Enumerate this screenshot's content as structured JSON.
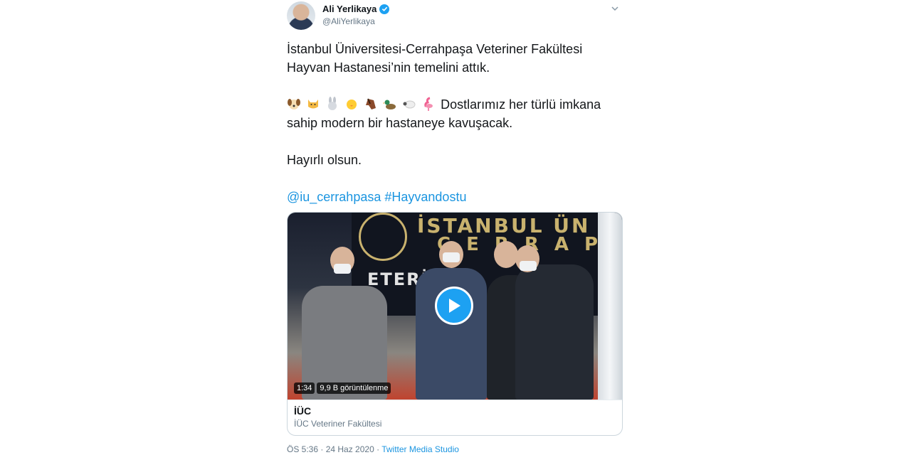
{
  "author": {
    "name": "Ali Yerlikaya",
    "handle": "@AliYerlikaya"
  },
  "tweet": {
    "line1": "İstanbul Üniversitesi-Cerrahpaşa Veteriner Fakültesi Hayvan Hastanesi’nin temelini attık.",
    "line2": "Dostlarımız her türlü imkana sahip modern bir hastaneye kavuşacak.",
    "line3": "Hayırlı olsun.",
    "mention": "@iu_cerrahpasa",
    "hashtag": "#Hayvandostu",
    "emoji_icons": [
      "dog-face-icon",
      "cat-face-icon",
      "rabbit-face-icon",
      "chick-icon",
      "horse-face-icon",
      "duck-icon",
      "sheep-icon",
      "flamingo-icon"
    ]
  },
  "media": {
    "duration": "1:34",
    "views": "9,9 B görüntülenme",
    "banner_line1": "İSTANBUL ÜN",
    "banner_line2": "CERRAP",
    "banner_line3": "ETERİM",
    "card_title": "İÜC",
    "card_subtitle": "İÜC Veteriner Fakültesi"
  },
  "footer": {
    "time_date": "ÖS 5:36 · 24 Haz 2020 · ",
    "source": "Twitter Media Studio"
  },
  "colors": {
    "accent": "#1da1f2",
    "link": "#1b95e0",
    "muted": "#657786"
  }
}
